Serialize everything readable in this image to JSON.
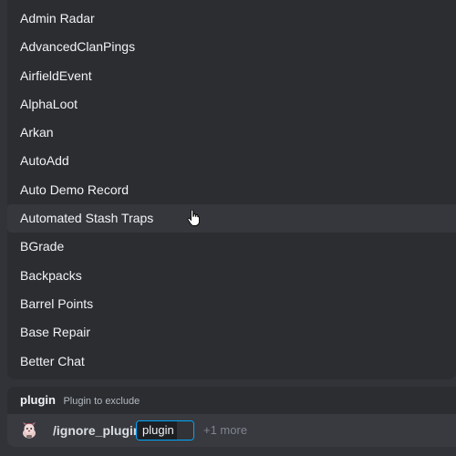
{
  "autocomplete": {
    "options": [
      {
        "label": "Admin Radar"
      },
      {
        "label": "AdvancedClanPings"
      },
      {
        "label": "AirfieldEvent"
      },
      {
        "label": "AlphaLoot"
      },
      {
        "label": "Arkan"
      },
      {
        "label": "AutoAdd"
      },
      {
        "label": "Auto Demo Record"
      },
      {
        "label": "Automated Stash Traps"
      },
      {
        "label": "BGrade"
      },
      {
        "label": "Backpacks"
      },
      {
        "label": "Barrel Points"
      },
      {
        "label": "Base Repair"
      },
      {
        "label": "Better Chat"
      }
    ],
    "hovered_index": 7
  },
  "parameter": {
    "name": "plugin",
    "description": "Plugin to exclude"
  },
  "command": {
    "icon": "bot-avatar-icon",
    "name": "/ignore_plugin",
    "option_value": "plugin",
    "more_label": "+1 more"
  },
  "colors": {
    "background": "#313338",
    "popup": "#2b2d31",
    "hover": "#35373c",
    "focus_border": "#00a8fc",
    "text": "#f2f3f5",
    "muted": "#80848e"
  }
}
